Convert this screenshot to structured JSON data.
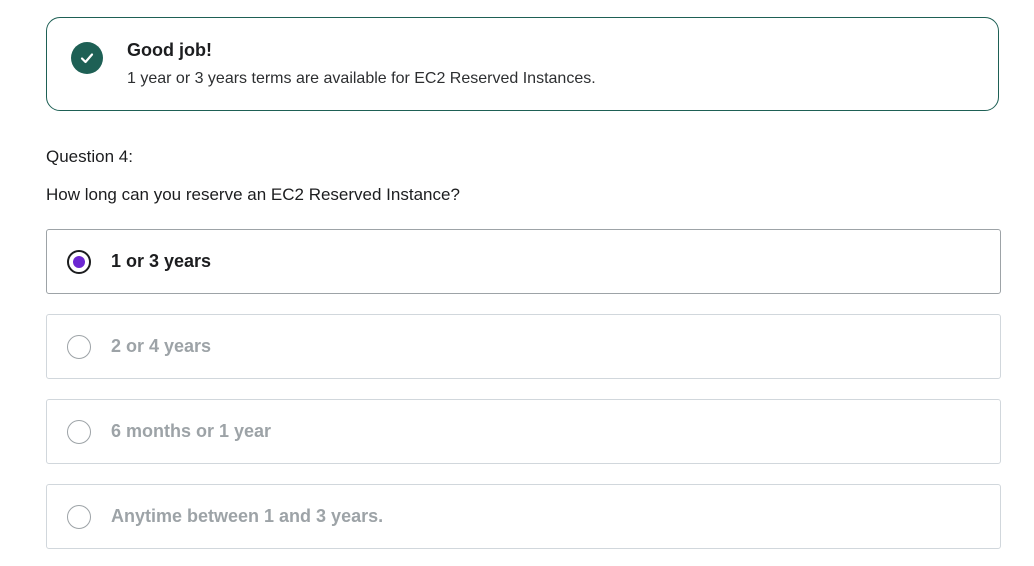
{
  "feedback": {
    "icon": "check-icon",
    "title": "Good job!",
    "text": "1 year or 3 years terms are available for EC2 Reserved Instances.",
    "accent": "#1e6055"
  },
  "question": {
    "number_label": "Question 4:",
    "prompt": "How long can you reserve an EC2 Reserved Instance?"
  },
  "options": [
    {
      "label": "1 or 3 years",
      "selected": true
    },
    {
      "label": "2 or 4 years",
      "selected": false
    },
    {
      "label": "6 months or 1 year",
      "selected": false
    },
    {
      "label": "Anytime between 1 and 3 years.",
      "selected": false
    }
  ],
  "colors": {
    "radio_selected": "#6d28d2",
    "disabled_text": "#9da3a7"
  }
}
